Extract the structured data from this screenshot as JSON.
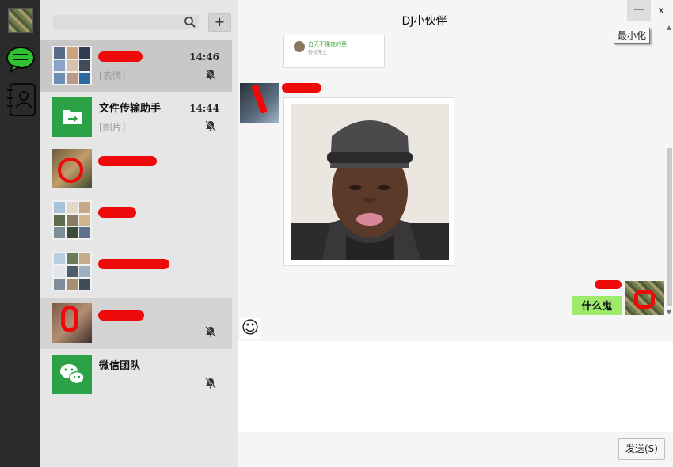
{
  "window": {
    "title": "DJ小伙伴",
    "minimize_symbol": "—",
    "close_symbol": "x",
    "minimize_tooltip": "最小化"
  },
  "sidebar": {
    "icons": [
      "chat-icon",
      "contacts-icon"
    ]
  },
  "search": {
    "placeholder": "",
    "add_symbol": "+"
  },
  "conversations": [
    {
      "name": "",
      "preview": "[表情]",
      "time": "14:46",
      "muted": true,
      "selected": true
    },
    {
      "name": "文件传输助手",
      "preview": "[图片]",
      "time": "14:44",
      "muted": true
    },
    {
      "name": "",
      "preview": "",
      "time": "",
      "muted": false
    },
    {
      "name": "",
      "preview": "",
      "time": "",
      "muted": false
    },
    {
      "name": "",
      "preview": "",
      "time": "",
      "muted": false
    },
    {
      "name": "",
      "preview": "",
      "time": "",
      "muted": true
    },
    {
      "name": "微信团队",
      "preview": "",
      "time": "",
      "muted": true
    }
  ],
  "messages": {
    "card_title": "白天不懂夜的黑",
    "card_sub": "轻松无主",
    "my_text": "什么鬼"
  },
  "composer": {
    "emoji_symbol": "☺",
    "send_label": "发送(S)"
  },
  "colors": {
    "rail": "#2b2b2b",
    "list_bg": "#e6e6e6",
    "selected_row": "#c8c8c8",
    "wechat_green": "#2ba245",
    "my_bubble": "#9eea6a",
    "redaction": "#ee0a0a"
  }
}
